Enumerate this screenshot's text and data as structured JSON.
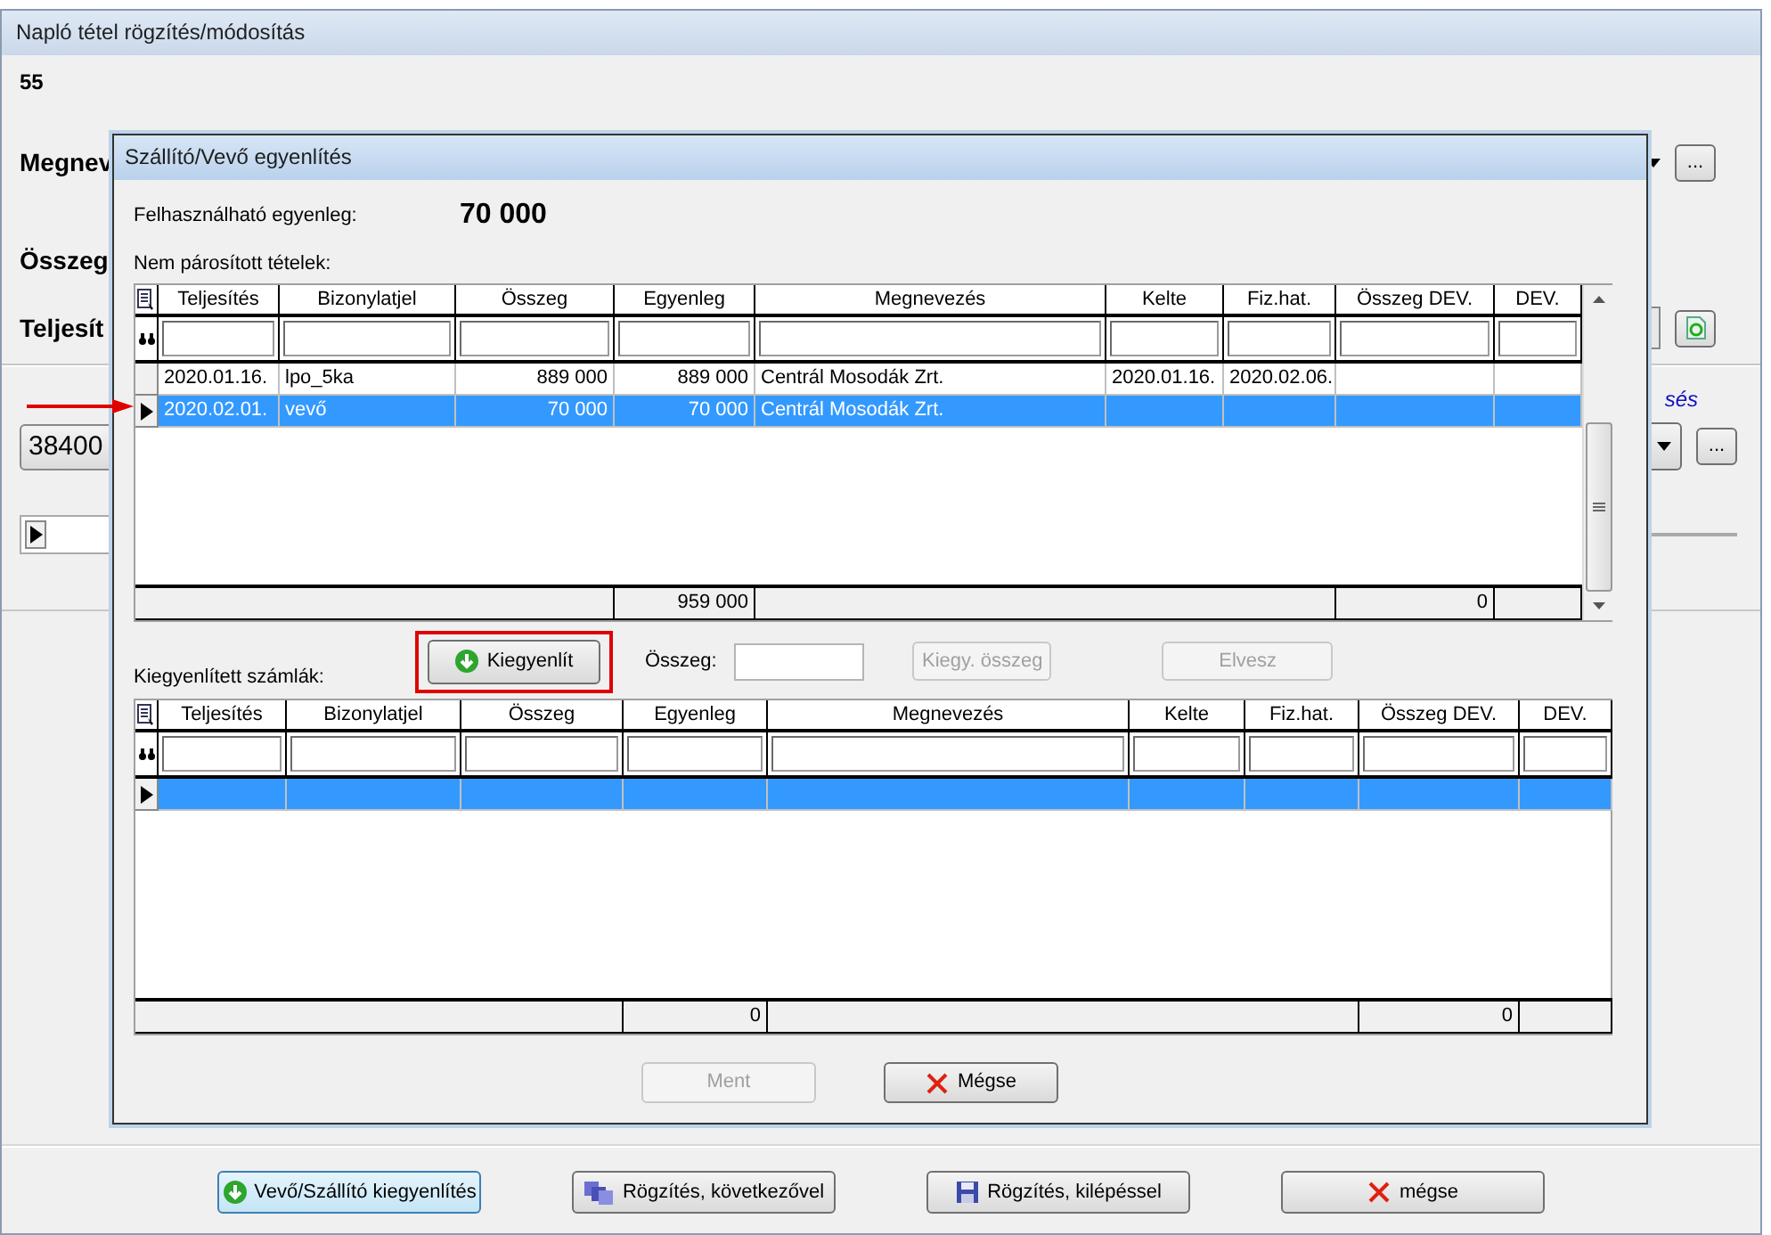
{
  "window": {
    "title": "Napló tétel rögzítés/módosítás",
    "record_number": "55",
    "name_label": "Megnev",
    "amount_label": "Összeg",
    "date_label": "Teljesít",
    "link_fragment": "sés",
    "account_value": "38400",
    "browse_buttons": [
      "...",
      "..."
    ]
  },
  "dialog": {
    "title": "Szállító/Vevő egyenlítés",
    "balance_label": "Felhasználható egyenleg:",
    "balance_value": "70 000",
    "unpaired_label": "Nem párosított tételek:",
    "unpaired_grid": {
      "columns": [
        "Teljesítés",
        "Bizonylatjel",
        "Összeg",
        "Egyenleg",
        "Megnevezés",
        "Kelte",
        "Fiz.hat.",
        "Összeg DEV.",
        "DEV."
      ],
      "rows": [
        {
          "teljesites": "2020.01.16.",
          "bizonylatjel": "lpo_5ka",
          "osszeg": "889 000",
          "egyenleg": "889 000",
          "megnevezes": "Centrál Mosodák Zrt.",
          "kelte": "2020.01.16.",
          "fiz_hat": "2020.02.06.",
          "selected": false
        },
        {
          "teljesites": "2020.02.01.",
          "bizonylatjel": "vevő",
          "osszeg": "70 000",
          "egyenleg": "70 000",
          "megnevezes": "Centrál Mosodák Zrt.",
          "selected": true
        }
      ],
      "totals": {
        "egyenleg": "959 000",
        "osszeg_dev": "0"
      }
    },
    "settle_button": {
      "label": "Kiegyenlít"
    },
    "amount_label": "Összeg:",
    "settle_amount_button": {
      "label": "Kiegy. összeg",
      "disabled": true
    },
    "remove_button": {
      "label": "Elvesz",
      "disabled": true
    },
    "settled_label": "Kiegyenlített számlák:",
    "settled_grid": {
      "columns": [
        "Teljesítés",
        "Bizonylatjel",
        "Összeg",
        "Egyenleg",
        "Megnevezés",
        "Kelte",
        "Fiz.hat.",
        "Összeg DEV.",
        "DEV."
      ],
      "rows": [
        {
          "selected": true
        }
      ],
      "totals": {
        "egyenleg": "0",
        "osszeg_dev": "0"
      }
    },
    "save_button": {
      "label": "Ment",
      "disabled": true
    },
    "cancel_button": {
      "label": "Mégse",
      "disabled": false
    }
  },
  "bottom_buttons": [
    {
      "label": "Vevő/Szállító kiegyenlítés",
      "kind": "balance",
      "selected": true
    },
    {
      "label": "Rögzítés, következővel",
      "kind": "next",
      "selected": false
    },
    {
      "label": "Rögzítés, kilépéssel",
      "kind": "save",
      "selected": false
    },
    {
      "label": "mégse",
      "kind": "cancel",
      "selected": false
    }
  ]
}
